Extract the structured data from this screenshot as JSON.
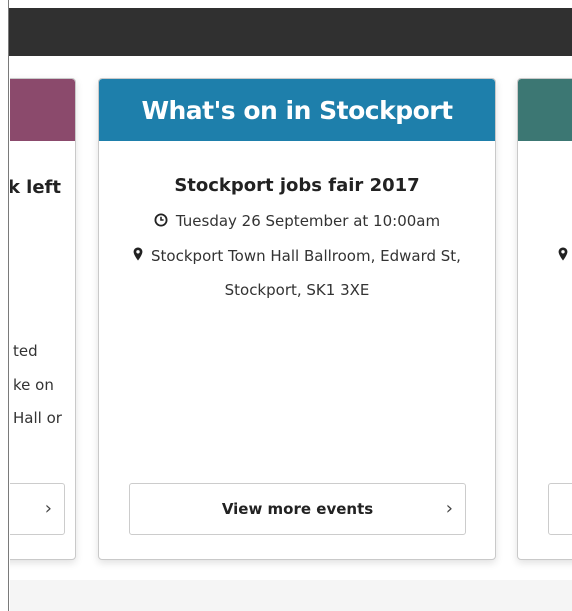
{
  "header": {},
  "cards": {
    "left": {
      "title_fragment": "k left",
      "text_lines": [
        "ted",
        "ke on",
        "Hall or"
      ],
      "chevron": "›"
    },
    "center": {
      "heading": "What's on in Stockport",
      "event_title": "Stockport jobs fair 2017",
      "datetime": "Tuesday 26 September at 10:00am",
      "location_line1": "Stockport Town Hall Ballroom, Edward St,",
      "location_line2": "Stockport, SK1 3XE",
      "button_label": "View more events",
      "chevron": "›"
    },
    "right": {}
  },
  "colors": {
    "topbar": "#303030",
    "left_header": "#8b4a6c",
    "center_header": "#1e7fab",
    "right_header": "#3c7773"
  },
  "icons": {
    "datetime": "clock-icon",
    "location": "map-pin-icon",
    "next": "chevron-right-icon"
  }
}
